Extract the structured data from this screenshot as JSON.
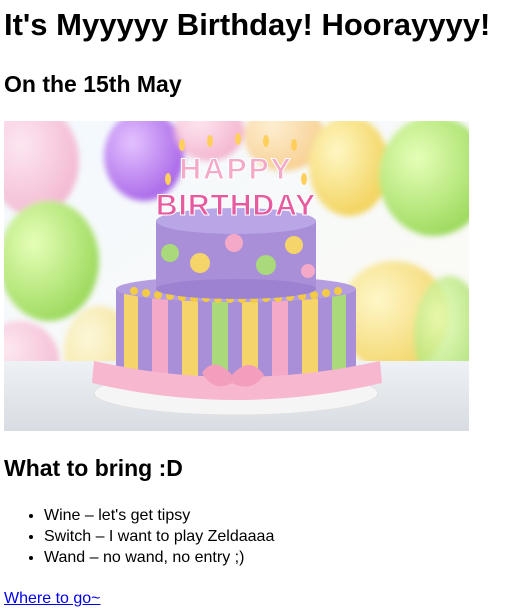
{
  "page": {
    "title": "It's Myyyyy Birthday! Hoorayyyy!",
    "date_heading": "On the 15th May",
    "hero_image": {
      "cake_topper_text": [
        "HAPPY",
        "BIRTHDAY"
      ],
      "colors": {
        "cake_purple": "#a98fd8",
        "stripe_yellow": "#f5d46a",
        "stripe_green": "#a9d97a",
        "stripe_pink": "#f4a9c8",
        "ribbon_pink": "#f7b7cf",
        "balloon_green": "#b9f07a",
        "balloon_purple": "#b97cf0"
      }
    },
    "bring_heading": "What to bring :D",
    "bring_items": [
      "Wine – let's get tipsy",
      "Switch – I want to play Zeldaaaa",
      "Wand – no wand, no entry ;)"
    ],
    "location_link": "Where to go~"
  }
}
